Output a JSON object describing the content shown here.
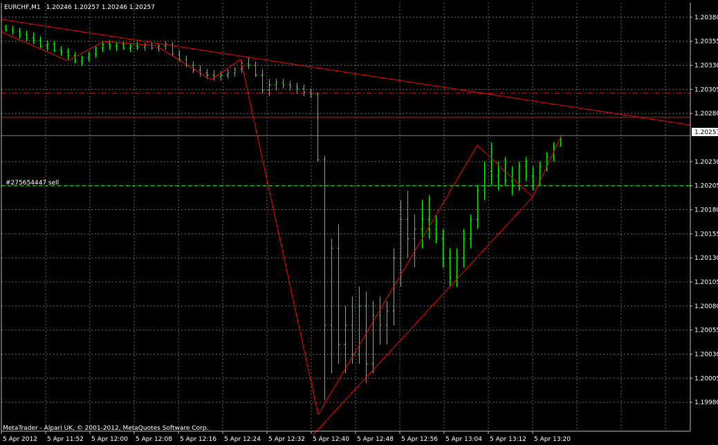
{
  "header": {
    "symbol": "EURCHF,M1",
    "ohlc": "1.20246 1.20257 1.20246 1.20257"
  },
  "copyright": "MetaTrader - Alpari UK, © 2001-2012, MetaQuotes Software Corp.",
  "order_label": "#275654447 sell",
  "current_price": "1.20257",
  "colors": {
    "background": "#000000",
    "grid": "#c0c0c0",
    "bars": "#00ff00",
    "trendlines": "#ff0000",
    "order_line": "#00ff00",
    "text": "#ffffff"
  },
  "chart_data": {
    "type": "ohlc",
    "symbol": "EURCHF",
    "timeframe": "M1",
    "ylim": [
      1.1995,
      1.20395
    ],
    "y_ticks": [
      "1.20380",
      "1.20355",
      "1.20330",
      "1.20305",
      "1.20280",
      "1.20257",
      "1.20230",
      "1.20205",
      "1.20180",
      "1.20155",
      "1.20130",
      "1.20105",
      "1.20080",
      "1.20055",
      "1.20030",
      "1.20005",
      "1.19980"
    ],
    "x_ticks": [
      "5 Apr 2012",
      "5 Apr 11:52",
      "5 Apr 12:00",
      "5 Apr 12:08",
      "5 Apr 12:16",
      "5 Apr 12:24",
      "5 Apr 12:32",
      "5 Apr 12:40",
      "5 Apr 12:48",
      "5 Apr 12:56",
      "5 Apr 13:04",
      "5 Apr 13:12",
      "5 Apr 13:20"
    ],
    "grid": true,
    "bars": [
      [
        1.2037,
        1.20372,
        1.20365,
        1.20367
      ],
      [
        1.20367,
        1.20371,
        1.20362,
        1.20365
      ],
      [
        1.20365,
        1.20369,
        1.20358,
        1.20362
      ],
      [
        1.20362,
        1.20366,
        1.20355,
        1.20358
      ],
      [
        1.20358,
        1.20364,
        1.20352,
        1.20356
      ],
      [
        1.20356,
        1.2036,
        1.20348,
        1.2035
      ],
      [
        1.2035,
        1.20356,
        1.20345,
        1.20352
      ],
      [
        1.20352,
        1.20355,
        1.20344,
        1.20346
      ],
      [
        1.20346,
        1.2035,
        1.2034,
        1.20344
      ],
      [
        1.20344,
        1.20348,
        1.20336,
        1.2034
      ],
      [
        1.2034,
        1.20344,
        1.20332,
        1.20334
      ],
      [
        1.20334,
        1.2034,
        1.2033,
        1.20338
      ],
      [
        1.20338,
        1.20344,
        1.20334,
        1.20342
      ],
      [
        1.20342,
        1.2035,
        1.20338,
        1.20348
      ],
      [
        1.20348,
        1.20355,
        1.20344,
        1.20352
      ],
      [
        1.20352,
        1.20356,
        1.20346,
        1.2035
      ],
      [
        1.2035,
        1.20354,
        1.20345,
        1.20352
      ],
      [
        1.20352,
        1.20355,
        1.20346,
        1.20348
      ],
      [
        1.20348,
        1.20353,
        1.20344,
        1.2035
      ],
      [
        1.2035,
        1.20354,
        1.20346,
        1.20349
      ],
      [
        1.20349,
        1.20353,
        1.20345,
        1.20351
      ],
      [
        1.20351,
        1.20354,
        1.20346,
        1.20348
      ],
      [
        1.20348,
        1.20352,
        1.20344,
        1.2035
      ],
      [
        1.2035,
        1.20355,
        1.20346,
        1.20352
      ],
      [
        1.20352,
        1.20354,
        1.2034,
        1.20342
      ],
      [
        1.20342,
        1.20346,
        1.20334,
        1.20336
      ],
      [
        1.20336,
        1.2034,
        1.20328,
        1.2033
      ],
      [
        1.2033,
        1.20334,
        1.20322,
        1.20325
      ],
      [
        1.20325,
        1.2033,
        1.20318,
        1.20322
      ],
      [
        1.20322,
        1.20326,
        1.20316,
        1.2032
      ],
      [
        1.2032,
        1.20325,
        1.20314,
        1.20318
      ],
      [
        1.20318,
        1.20324,
        1.20314,
        1.2032
      ],
      [
        1.2032,
        1.20326,
        1.20316,
        1.20322
      ],
      [
        1.20322,
        1.20328,
        1.20318,
        1.20326
      ],
      [
        1.20326,
        1.20334,
        1.20322,
        1.20332
      ],
      [
        1.20332,
        1.20338,
        1.20326,
        1.2033
      ],
      [
        1.2033,
        1.20334,
        1.20318,
        1.2032
      ],
      [
        1.2032,
        1.20326,
        1.203,
        1.20304
      ],
      [
        1.20304,
        1.20316,
        1.20298,
        1.2031
      ],
      [
        1.2031,
        1.20316,
        1.20304,
        1.20312
      ],
      [
        1.20312,
        1.20316,
        1.20306,
        1.2031
      ],
      [
        1.2031,
        1.20314,
        1.20304,
        1.20308
      ],
      [
        1.20308,
        1.20312,
        1.203,
        1.20306
      ],
      [
        1.20306,
        1.2031,
        1.20298,
        1.20302
      ],
      [
        1.20302,
        1.20306,
        1.20296,
        1.203
      ],
      [
        1.203,
        1.20302,
        1.2023,
        1.20232
      ],
      [
        1.20232,
        1.20236,
        1.19982,
        1.2006
      ],
      [
        1.2006,
        1.2015,
        1.2001,
        1.2014
      ],
      [
        1.2014,
        1.20165,
        1.2002,
        1.2004
      ],
      [
        1.2004,
        1.2008,
        1.2001,
        1.2006
      ],
      [
        1.2006,
        1.2009,
        1.2002,
        1.2003
      ],
      [
        1.2003,
        1.201,
        1.2002,
        1.2008
      ],
      [
        1.2008,
        1.20095,
        1.2,
        1.2002
      ],
      [
        1.2002,
        1.20085,
        1.2001,
        1.2007
      ],
      [
        1.2007,
        1.2009,
        1.2004,
        1.2006
      ],
      [
        1.2006,
        1.20085,
        1.2004,
        1.20075
      ],
      [
        1.20075,
        1.2014,
        1.2006,
        1.2013
      ],
      [
        1.2013,
        1.2019,
        1.201,
        1.2017
      ],
      [
        1.2017,
        1.202,
        1.2013,
        1.2015
      ],
      [
        1.2015,
        1.20175,
        1.2012,
        1.2016
      ],
      [
        1.2016,
        1.2019,
        1.2014,
        1.2017
      ],
      [
        1.2017,
        1.20195,
        1.2015,
        1.2016
      ],
      [
        1.2016,
        1.20175,
        1.20145,
        1.2015
      ],
      [
        1.2015,
        1.2016,
        1.2012,
        1.2013
      ],
      [
        1.2013,
        1.2014,
        1.201,
        1.2011
      ],
      [
        1.2011,
        1.2014,
        1.201,
        1.2013
      ],
      [
        1.2013,
        1.2016,
        1.2012,
        1.2015
      ],
      [
        1.2015,
        1.20175,
        1.2014,
        1.2017
      ],
      [
        1.2017,
        1.20205,
        1.2016,
        1.202
      ],
      [
        1.202,
        1.2023,
        1.2019,
        1.2022
      ],
      [
        1.2022,
        1.2025,
        1.20205,
        1.20215
      ],
      [
        1.20215,
        1.2023,
        1.202,
        1.2022
      ],
      [
        1.2022,
        1.20235,
        1.20205,
        1.2021
      ],
      [
        1.2021,
        1.20225,
        1.20195,
        1.20205
      ],
      [
        1.20205,
        1.2023,
        1.202,
        1.20225
      ],
      [
        1.20225,
        1.20235,
        1.2021,
        1.20215
      ],
      [
        1.20215,
        1.20225,
        1.202,
        1.2021
      ],
      [
        1.2021,
        1.2023,
        1.20205,
        1.20225
      ],
      [
        1.20225,
        1.2024,
        1.2022,
        1.20235
      ],
      [
        1.20235,
        1.2025,
        1.2023,
        1.20245
      ],
      [
        1.20246,
        1.20257,
        1.20246,
        1.20257
      ]
    ],
    "horizontal_levels": [
      {
        "price": 1.20301,
        "style": "dashdot",
        "color": "#ff0000"
      },
      {
        "price": 1.20276,
        "style": "solid",
        "color": "#ff0000"
      },
      {
        "price": 1.20257,
        "style": "solid",
        "color": "#808080"
      },
      {
        "price": 1.20205,
        "style": "dashed",
        "color": "#00ff00"
      }
    ]
  }
}
